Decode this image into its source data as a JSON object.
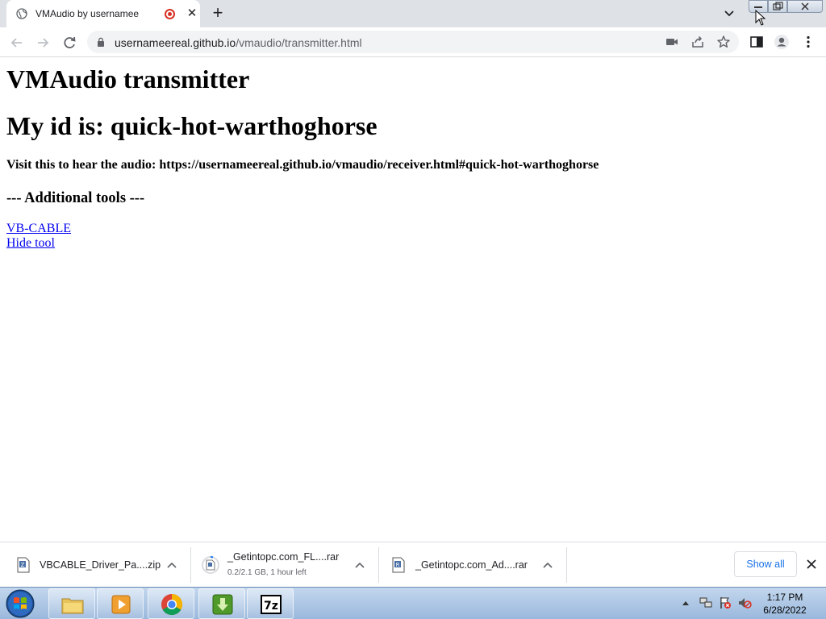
{
  "browser": {
    "tab": {
      "title": "VMAudio by usernamee"
    },
    "address": {
      "host": "usernameereal.github.io",
      "path": "/vmaudio/transmitter.html"
    }
  },
  "page": {
    "title": "VMAudio transmitter",
    "id_heading": "My id is: quick-hot-warthoghorse",
    "visit_text": "Visit this to hear the audio: https://usernameereal.github.io/vmaudio/receiver.html#quick-hot-warthoghorse",
    "tools_heading": "--- Additional tools ---",
    "links": [
      "VB-CABLE",
      "Hide tool"
    ]
  },
  "downloads": {
    "items": [
      {
        "name": "VBCABLE_Driver_Pa....zip",
        "status": ""
      },
      {
        "name": "_Getintopc.com_FL....rar",
        "status": "0.2/2.1 GB, 1 hour left"
      },
      {
        "name": "_Getintopc.com_Ad....rar",
        "status": ""
      }
    ],
    "show_all_label": "Show all"
  },
  "taskbar": {
    "time": "1:17 PM",
    "date": "6/28/2022"
  },
  "colors": {
    "link": "#0000ee",
    "accent": "#1a73e8",
    "tabstrip": "#dee1e6",
    "record": "#d93025"
  }
}
